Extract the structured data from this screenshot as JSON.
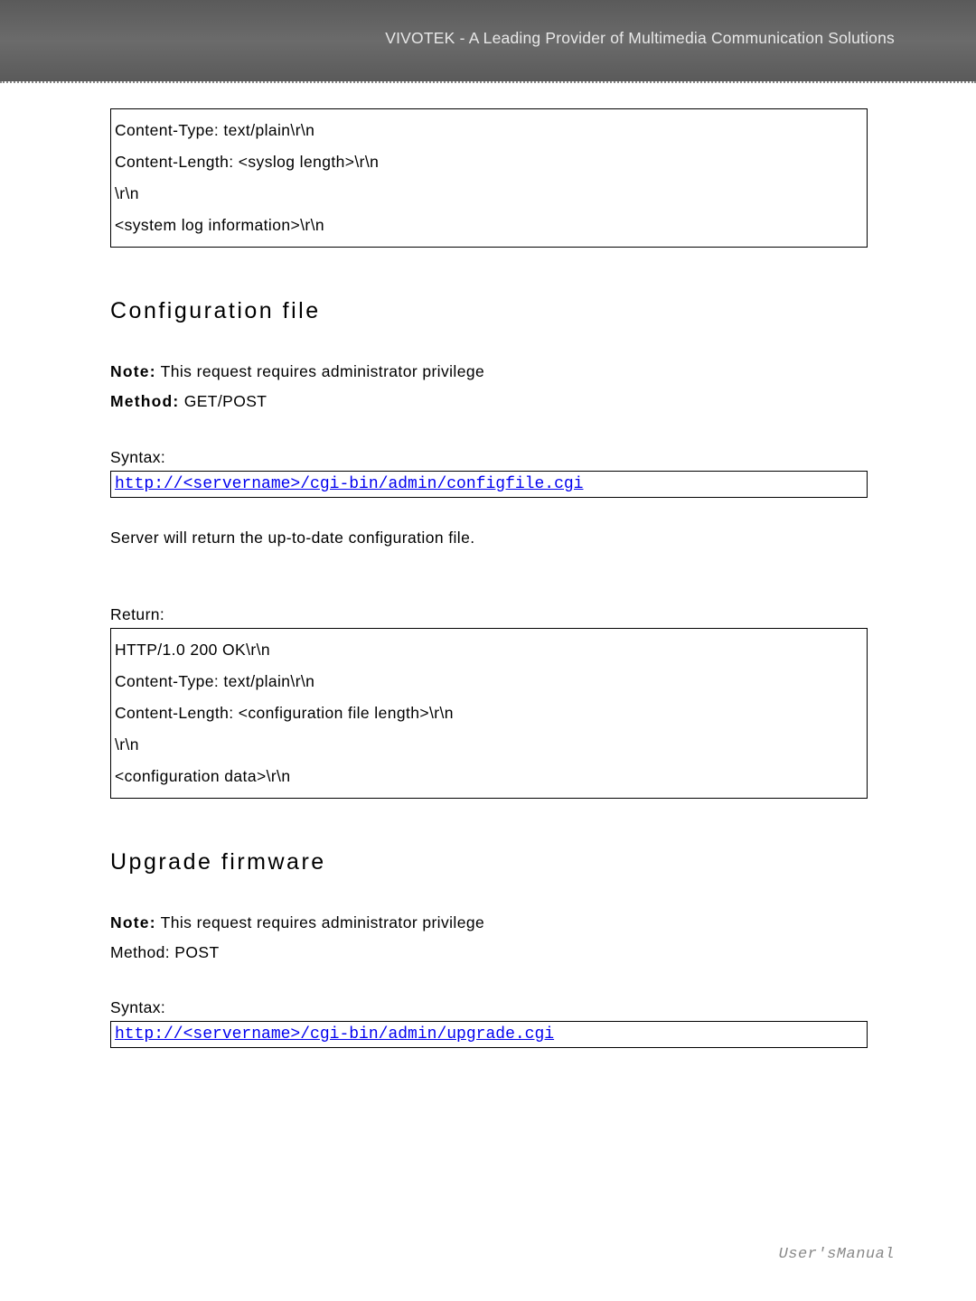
{
  "header": {
    "title": "VIVOTEK - A Leading Provider of Multimedia Communication Solutions"
  },
  "box1": {
    "l1": "Content-Type: text/plain\\r\\n",
    "l2": "Content-Length: <syslog length>\\r\\n",
    "l3": "\\r\\n",
    "l4": "<system log information>\\r\\n"
  },
  "s1": {
    "heading": "Configuration file",
    "note_b": "Note:",
    "note_t": " This request requires administrator privilege",
    "method_b": "Method:",
    "method_t": " GET/POST",
    "syntax": "Syntax:",
    "url": "http://<servername>/cgi-bin/admin/configfile.cgi",
    "desc": "Server will return the up-to-date configuration file.",
    "return": "Return:"
  },
  "box2": {
    "l1": "HTTP/1.0 200 OK\\r\\n",
    "l2": "Content-Type: text/plain\\r\\n",
    "l3": "Content-Length: <configuration file length>\\r\\n",
    "l4": "\\r\\n",
    "l5": "<configuration data>\\r\\n"
  },
  "s2": {
    "heading": "Upgrade firmware",
    "note_b": "Note:",
    "note_t": " This request requires administrator privilege",
    "method": "Method: POST",
    "syntax": "Syntax:",
    "url": "http://<servername>/cgi-bin/admin/upgrade.cgi"
  },
  "footer": {
    "right": "User'sManual"
  }
}
